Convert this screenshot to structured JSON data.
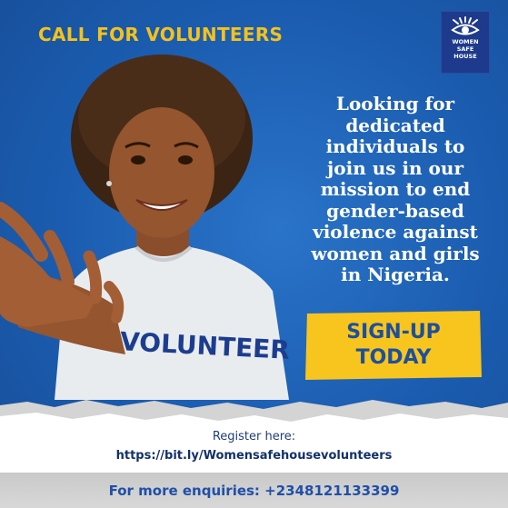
{
  "headline": "CALL FOR VOLUNTEERS",
  "logo": {
    "line1": "WOMEN",
    "line2": "SAFE",
    "line3": "HOUSE",
    "icon": "eye-icon"
  },
  "figure": {
    "shirt_text": "VOLUNTEER"
  },
  "message": "Looking for dedicated individuals to join us in our mission to end gender-based violence against women and girls in Nigeria.",
  "cta": {
    "line1": "SIGN-UP",
    "line2": "TODAY"
  },
  "register": {
    "label": "Register here:",
    "link": "https://bit.ly/Womensafehousevolunteers"
  },
  "enquiries": "For more enquiries: +2348121133399",
  "colors": {
    "background": "#1b5cb0",
    "accent_yellow": "#f4c21a",
    "cta_text": "#1d4f9e",
    "footer_grey": "#d0d0d0"
  }
}
